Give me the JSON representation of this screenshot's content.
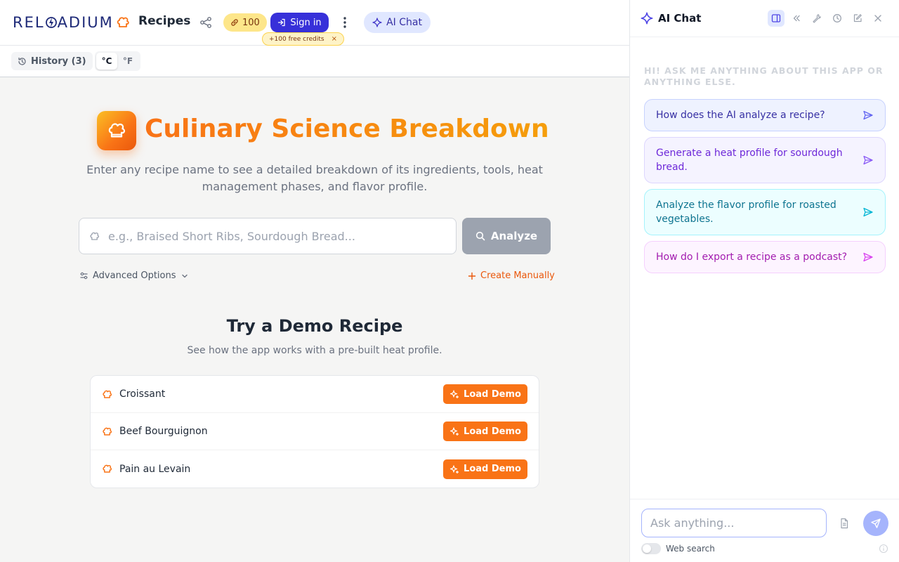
{
  "header": {
    "brand_left": "REL",
    "brand_right": "ADIUM",
    "app_title": "Recipes",
    "credits": "100",
    "signin_label": "Sign in",
    "free_credits": "+100 free credits",
    "free_close": "×",
    "ai_chat_label": "AI Chat"
  },
  "subbar": {
    "history_label": "History (3)",
    "units": [
      "°C",
      "°F"
    ],
    "selected_unit": "°C"
  },
  "main": {
    "title": "Culinary Science Breakdown",
    "subtitle": "Enter any recipe name to see a detailed breakdown of its ingredients, tools, heat management phases, and flavor profile.",
    "search_placeholder": "e.g., Braised Short Ribs, Sourdough Bread...",
    "search_value": "",
    "analyze_label": "Analyze",
    "advanced_label": "Advanced Options",
    "create_label": "Create Manually",
    "demo_title": "Try a Demo Recipe",
    "demo_subtitle": "See how the app works with a pre-built heat profile.",
    "demos": [
      {
        "name": "Croissant",
        "button": "Load Demo"
      },
      {
        "name": "Beef Bourguignon",
        "button": "Load Demo"
      },
      {
        "name": "Pain au Levain",
        "button": "Load Demo"
      }
    ]
  },
  "chat": {
    "title": "AI Chat",
    "hint": "Hi! Ask me anything about this app or anything else.",
    "suggestions": [
      "How does the AI analyze a recipe?",
      "Generate a heat profile for sourdough bread.",
      "Analyze the flavor profile for roasted vegetables.",
      "How do I export a recipe as a podcast?"
    ],
    "input_placeholder": "Ask anything...",
    "web_search_label": "Web search",
    "web_search_enabled": false
  },
  "icons": {
    "header": [
      "bolt-logo-icon",
      "chef-hat-icon",
      "share-icon",
      "link-icon",
      "sign-in-icon",
      "more-vertical-icon",
      "sparkle-icon"
    ],
    "chat_header": [
      "sparkle-icon",
      "panel-toggle-icon",
      "collapse-left-icon",
      "wrench-icon",
      "clock-icon",
      "edit-icon",
      "close-icon"
    ]
  },
  "colors": {
    "accent_orange": "#f97316",
    "primary_indigo": "#3730d9",
    "brand_navy": "#1e2a78"
  }
}
